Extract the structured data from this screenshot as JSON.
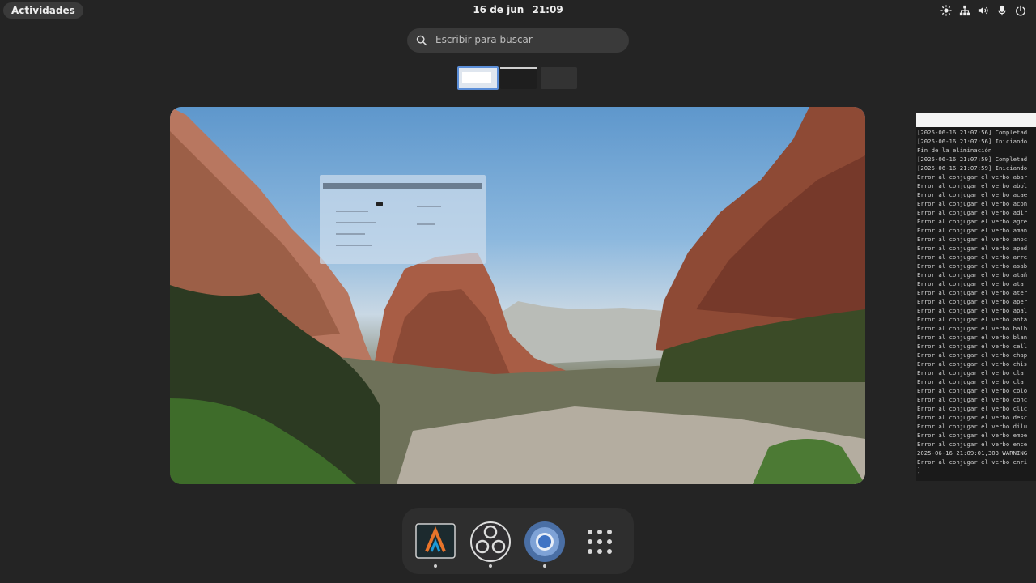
{
  "topbar": {
    "activities_label": "Actividades",
    "date": "16 de jun",
    "time": "21:09",
    "tray_icons": [
      "brightness-icon",
      "network-icon",
      "volume-icon",
      "microphone-icon",
      "power-icon"
    ]
  },
  "search": {
    "placeholder": "Escribir para buscar"
  },
  "workspaces": {
    "count": 3,
    "active_index": 0
  },
  "terminal": {
    "lines": [
      "[2025-06-16 21:07:56] Completad",
      "[2025-06-16 21:07:56] Iniciando",
      "Fin de la eliminación",
      "[2025-06-16 21:07:59] Completad",
      "[2025-06-16 21:07:59] Iniciando",
      "Error al conjugar el verbo abar",
      "Error al conjugar el verbo abol",
      "Error al conjugar el verbo acae",
      "Error al conjugar el verbo acon",
      "Error al conjugar el verbo adir",
      "Error al conjugar el verbo agre",
      "Error al conjugar el verbo aman",
      "Error al conjugar el verbo anoc",
      "Error al conjugar el verbo aped",
      "Error al conjugar el verbo arre",
      "Error al conjugar el verbo asab",
      "Error al conjugar el verbo atañ",
      "Error al conjugar el verbo atar",
      "Error al conjugar el verbo ater",
      "Error al conjugar el verbo aper",
      "Error al conjugar el verbo apal",
      "Error al conjugar el verbo anta",
      "Error al conjugar el verbo balb",
      "Error al conjugar el verbo blan",
      "Error al conjugar el verbo cell",
      "Error al conjugar el verbo chap",
      "Error al conjugar el verbo chis",
      "Error al conjugar el verbo clar",
      "Error al conjugar el verbo clar",
      "Error al conjugar el verbo colo",
      "Error al conjugar el verbo conc",
      "Error al conjugar el verbo clic",
      "Error al conjugar el verbo desc",
      "Error al conjugar el verbo dilu",
      "Error al conjugar el verbo empe",
      "Error al conjugar el verbo ence",
      "2025-06-16 21:09:01,303 WARNING",
      "Error al conjugar el verbo enri"
    ],
    "cursor": "]"
  },
  "dock": {
    "apps": [
      {
        "name": "arduino-ide",
        "running": true
      },
      {
        "name": "obs-studio",
        "running": true
      },
      {
        "name": "chromium",
        "running": true
      },
      {
        "name": "show-apps",
        "running": false
      }
    ]
  },
  "colors": {
    "background": "#242424",
    "accent": "#5b8ed8"
  }
}
